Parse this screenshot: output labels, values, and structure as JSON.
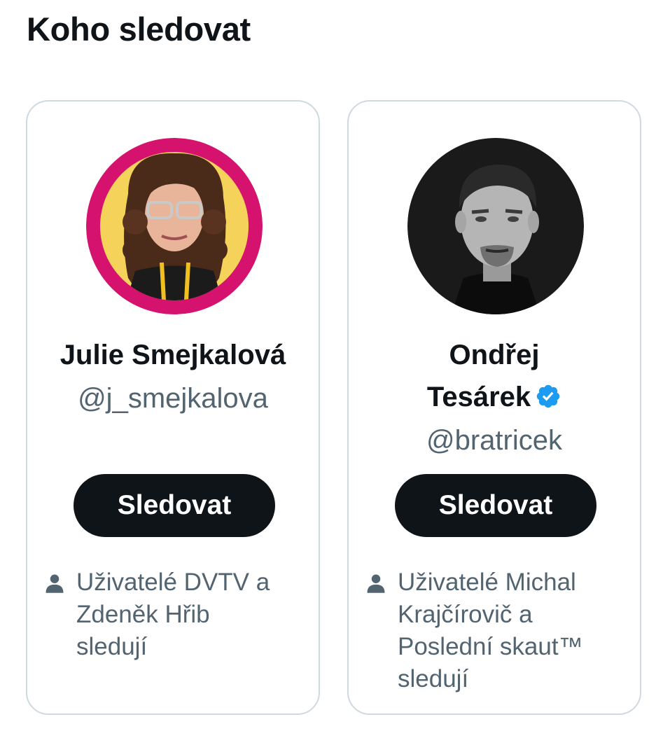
{
  "section": {
    "title": "Koho sledovat"
  },
  "cards": [
    {
      "name": "Julie Smejkalová",
      "handle": "@j_smejkalova",
      "follow_label": "Sledovat",
      "social_context": "Uživatelé DVTV a Zdeněk Hřib sledují",
      "avatar_ring_color": "#d6126f",
      "avatar_bg_color": "#f5d35a"
    },
    {
      "name_line1": "Ondřej",
      "name_line2": "Tesárek",
      "handle": "@bratricek",
      "verified": true,
      "follow_label": "Sledovat",
      "social_context": "Uživatelé Michal Krajčírovič a Poslední skaut™ sledují",
      "avatar_bg_color": "#1a1a1a"
    }
  ],
  "colors": {
    "text_primary": "#0f1419",
    "text_secondary": "#536471",
    "border": "#cfd9de",
    "button_bg": "#0f1419",
    "verified_badge": "#1d9bf0"
  },
  "icons": {
    "verified": "verified-badge-icon",
    "followers": "person-icon"
  }
}
